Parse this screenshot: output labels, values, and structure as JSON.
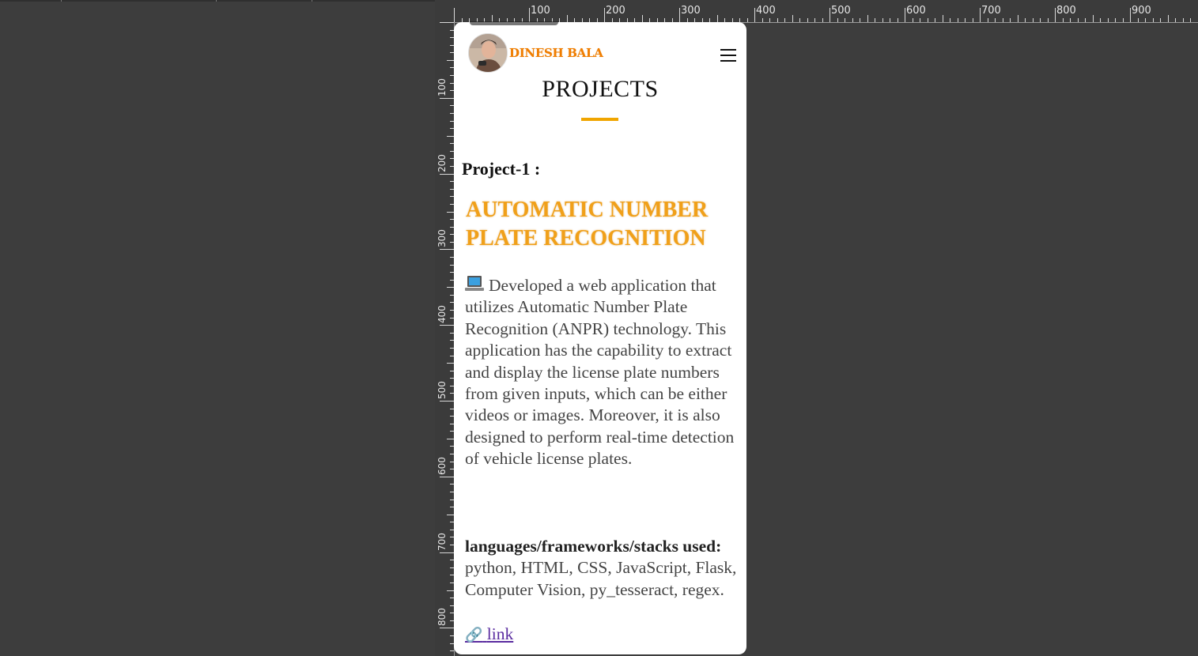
{
  "ruler": {
    "top_labels": [
      "100",
      "200",
      "300",
      "400",
      "500",
      "600",
      "700",
      "800",
      "900"
    ],
    "left_labels": [
      "100",
      "200",
      "300",
      "400",
      "500",
      "600",
      "700",
      "800"
    ]
  },
  "navbar": {
    "brand": "DINESH BALA",
    "menu_icon": "hamburger-menu-icon",
    "avatar_icon": "profile-avatar"
  },
  "section": {
    "title": "PROJECTS",
    "accent_color": "#f0a500"
  },
  "project": {
    "label": "Project-1 :",
    "name": "AUTOMATIC NUMBER PLATE RECOGNITION",
    "desc_icon": "laptop-icon",
    "description": "Developed a web application that utilizes Automatic Number Plate Recognition (ANPR) technology. This application has the capability to extract and display the license plate numbers from given inputs, which can be either videos or images. Moreover, it is also designed to perform real-time detection of vehicle license plates.",
    "stack_label": "languages/frameworks/stacks used:",
    "stack_values": "python, HTML, CSS, JavaScript, Flask, Computer Vision, py_tesseract, regex.",
    "link_icon": "chain-link-icon",
    "link_text": "link"
  },
  "colors": {
    "brand": "#f07d00",
    "project_name": "#f0a01a",
    "link": "#5a2ca0",
    "canvas_bg": "#3d3d3d"
  }
}
